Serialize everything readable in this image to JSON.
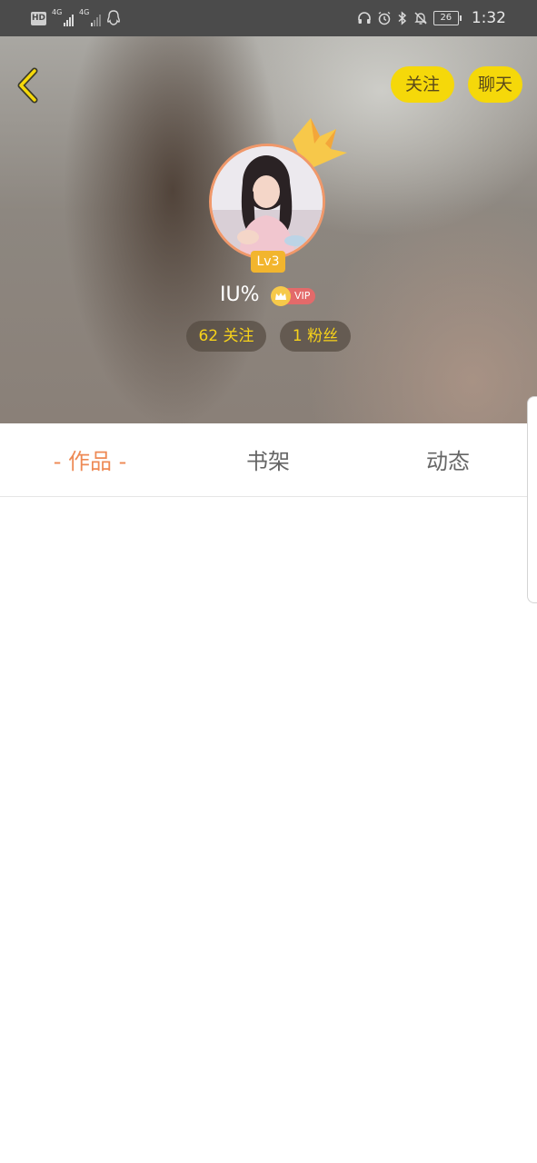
{
  "status_bar": {
    "hd_label": "HD",
    "signal1_type": "4G",
    "signal2_type": "4G",
    "battery": "26",
    "time": "1:32",
    "icons": [
      "hd-icon",
      "signal-icon",
      "signal-icon",
      "qq-icon",
      "headphones-icon",
      "alarm-icon",
      "bluetooth-icon",
      "mute-bell-icon",
      "battery-icon"
    ]
  },
  "header": {
    "follow_label": "关注",
    "chat_label": "聊天",
    "back_icon": "chevron-left-icon"
  },
  "profile": {
    "level": "Lv3",
    "username": "IU%",
    "vip_label": "VIP",
    "following": "62 关注",
    "fans": "1 粉丝"
  },
  "tabs": {
    "works": "作品",
    "shelf": "书架",
    "feed": "动态",
    "active": "works"
  },
  "colors": {
    "accent_yellow": "#f5d80a",
    "tab_active": "#ee8a55",
    "level_badge": "#f2b52e",
    "vip_red": "#e36a6a"
  }
}
